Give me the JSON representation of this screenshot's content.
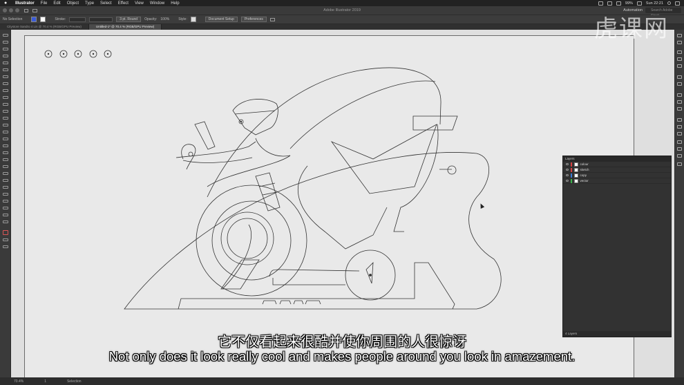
{
  "menubar": {
    "app": "Illustrator",
    "items": [
      "File",
      "Edit",
      "Object",
      "Type",
      "Select",
      "Effect",
      "View",
      "Window",
      "Help"
    ],
    "battery": "99%",
    "clock": "Sun 22:21"
  },
  "titlebar": {
    "title": "Adobe Illustrator 2019",
    "workspace": "Automation",
    "search_placeholder": "Search Adobe Stock"
  },
  "control": {
    "selection": "No Selection",
    "stroke_label": "Stroke:",
    "brush": "3 pt. Round",
    "opacity_label": "Opacity:",
    "opacity_value": "100%",
    "style_label": "Style:",
    "doc_setup": "Document Setup",
    "preferences": "Preferences"
  },
  "tabs": [
    {
      "label": "Citystore Sandro 4 Lin @ 70.4 % (RGB/GPU Preview)"
    },
    {
      "label": "Untitled-1* @ 70.4 % (RGB/GPU Preview)"
    }
  ],
  "layers": {
    "title": "Layers",
    "rows": [
      {
        "name": "colour",
        "color": "#d94040"
      },
      {
        "name": "sketch",
        "color": "#d94040"
      },
      {
        "name": "copy",
        "color": "#3a7bd5"
      },
      {
        "name": "vector",
        "color": "#3ab34a"
      }
    ],
    "footer": "4 Layers"
  },
  "status": {
    "zoom": "70.4%",
    "page": "1",
    "tool": "Selection"
  },
  "watermark": "虎课网",
  "subtitles": {
    "cn": "它不仅看起来很酷并使你周围的人很惊讶",
    "en": "Not only does it look really cool and makes people around you look in amazement."
  }
}
